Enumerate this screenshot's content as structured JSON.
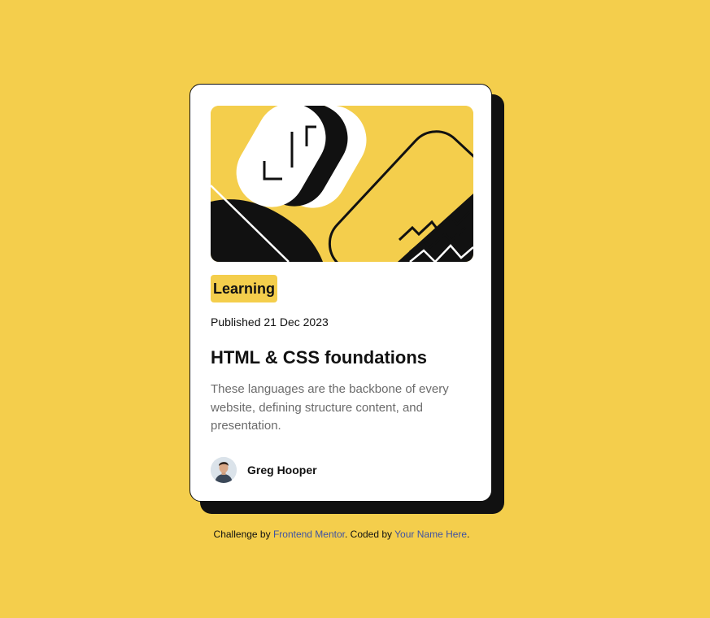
{
  "card": {
    "category": "Learning",
    "published": "Published 21 Dec 2023",
    "title": "HTML & CSS foundations",
    "description": "These languages are the backbone of every website, defining structure content, and presentation.",
    "author_name": "Greg Hooper"
  },
  "attribution": {
    "prefix": "Challenge by ",
    "link1": "Frontend Mentor",
    "middle": ". Coded by ",
    "link2": "Your Name Here",
    "suffix": "."
  },
  "colors": {
    "background": "#f4ce4c",
    "card": "#ffffff",
    "shadow": "#111111",
    "text": "#111111",
    "muted": "#6b6b6b",
    "link": "#3e52a3"
  },
  "icons": {
    "hero": "abstract-illustration",
    "avatar": "author-avatar"
  }
}
